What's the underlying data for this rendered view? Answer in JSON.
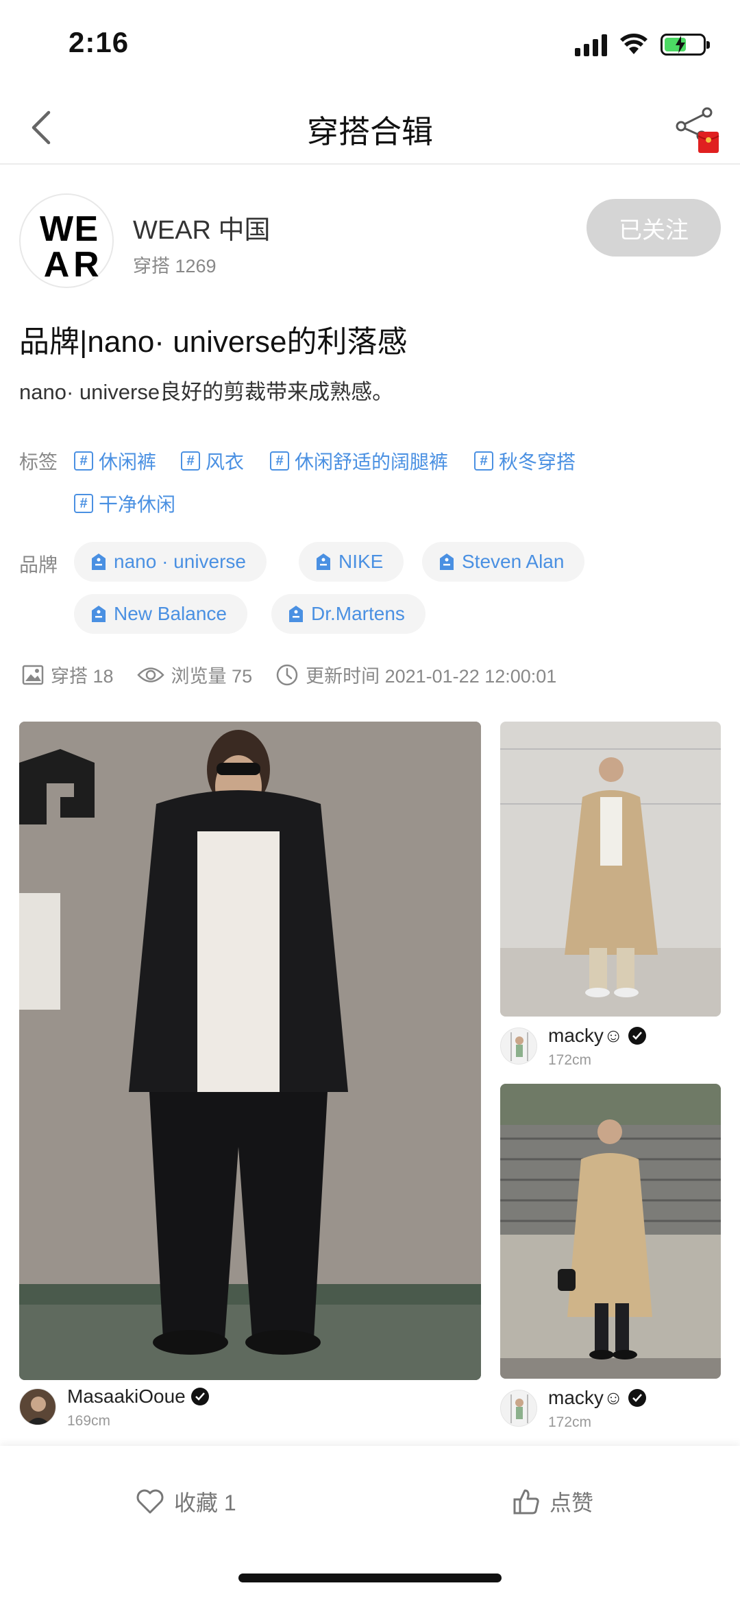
{
  "status_bar": {
    "time": "2:16"
  },
  "nav": {
    "title": "穿搭合辑"
  },
  "profile": {
    "logo_letters": [
      "W",
      "E",
      "A",
      "R"
    ],
    "name": "WEAR 中国",
    "outfit_count": "穿搭 1269",
    "follow_label": "已关注"
  },
  "collection": {
    "title": "品牌|nano· universe的利落感",
    "description": "nano· universe良好的剪裁带来成熟感。"
  },
  "tags": {
    "label": "标签",
    "hash_symbol": "#",
    "items": [
      "休闲裤",
      "风衣",
      "休闲舒适的阔腿裤",
      "秋冬穿搭",
      "干净休闲"
    ]
  },
  "brands": {
    "label": "品牌",
    "items": [
      "nano · universe",
      "NIKE",
      "Steven Alan",
      "New Balance",
      "Dr.Martens"
    ]
  },
  "stats": {
    "outfits": "穿搭 18",
    "views": "浏览量 75",
    "updated": "更新时间 2021-01-22 12:00:01"
  },
  "posts": [
    {
      "user": "MasaakiOoue",
      "height": "169cm"
    },
    {
      "user": "macky☺",
      "height": "172cm"
    },
    {
      "user": "macky☺",
      "height": "172cm"
    }
  ],
  "bottom_bar": {
    "favorite_label": "收藏 1",
    "like_label": "点赞"
  },
  "colors": {
    "accent": "#4a90e2",
    "follow_bg": "#d5d5d5",
    "battery": "#4cd964"
  },
  "icons": [
    "back-icon",
    "share-icon",
    "red-envelope-icon",
    "hash-icon",
    "tag-icon",
    "image-icon",
    "eye-icon",
    "clock-icon",
    "verified-icon",
    "heart-icon",
    "thumbs-up-icon"
  ]
}
